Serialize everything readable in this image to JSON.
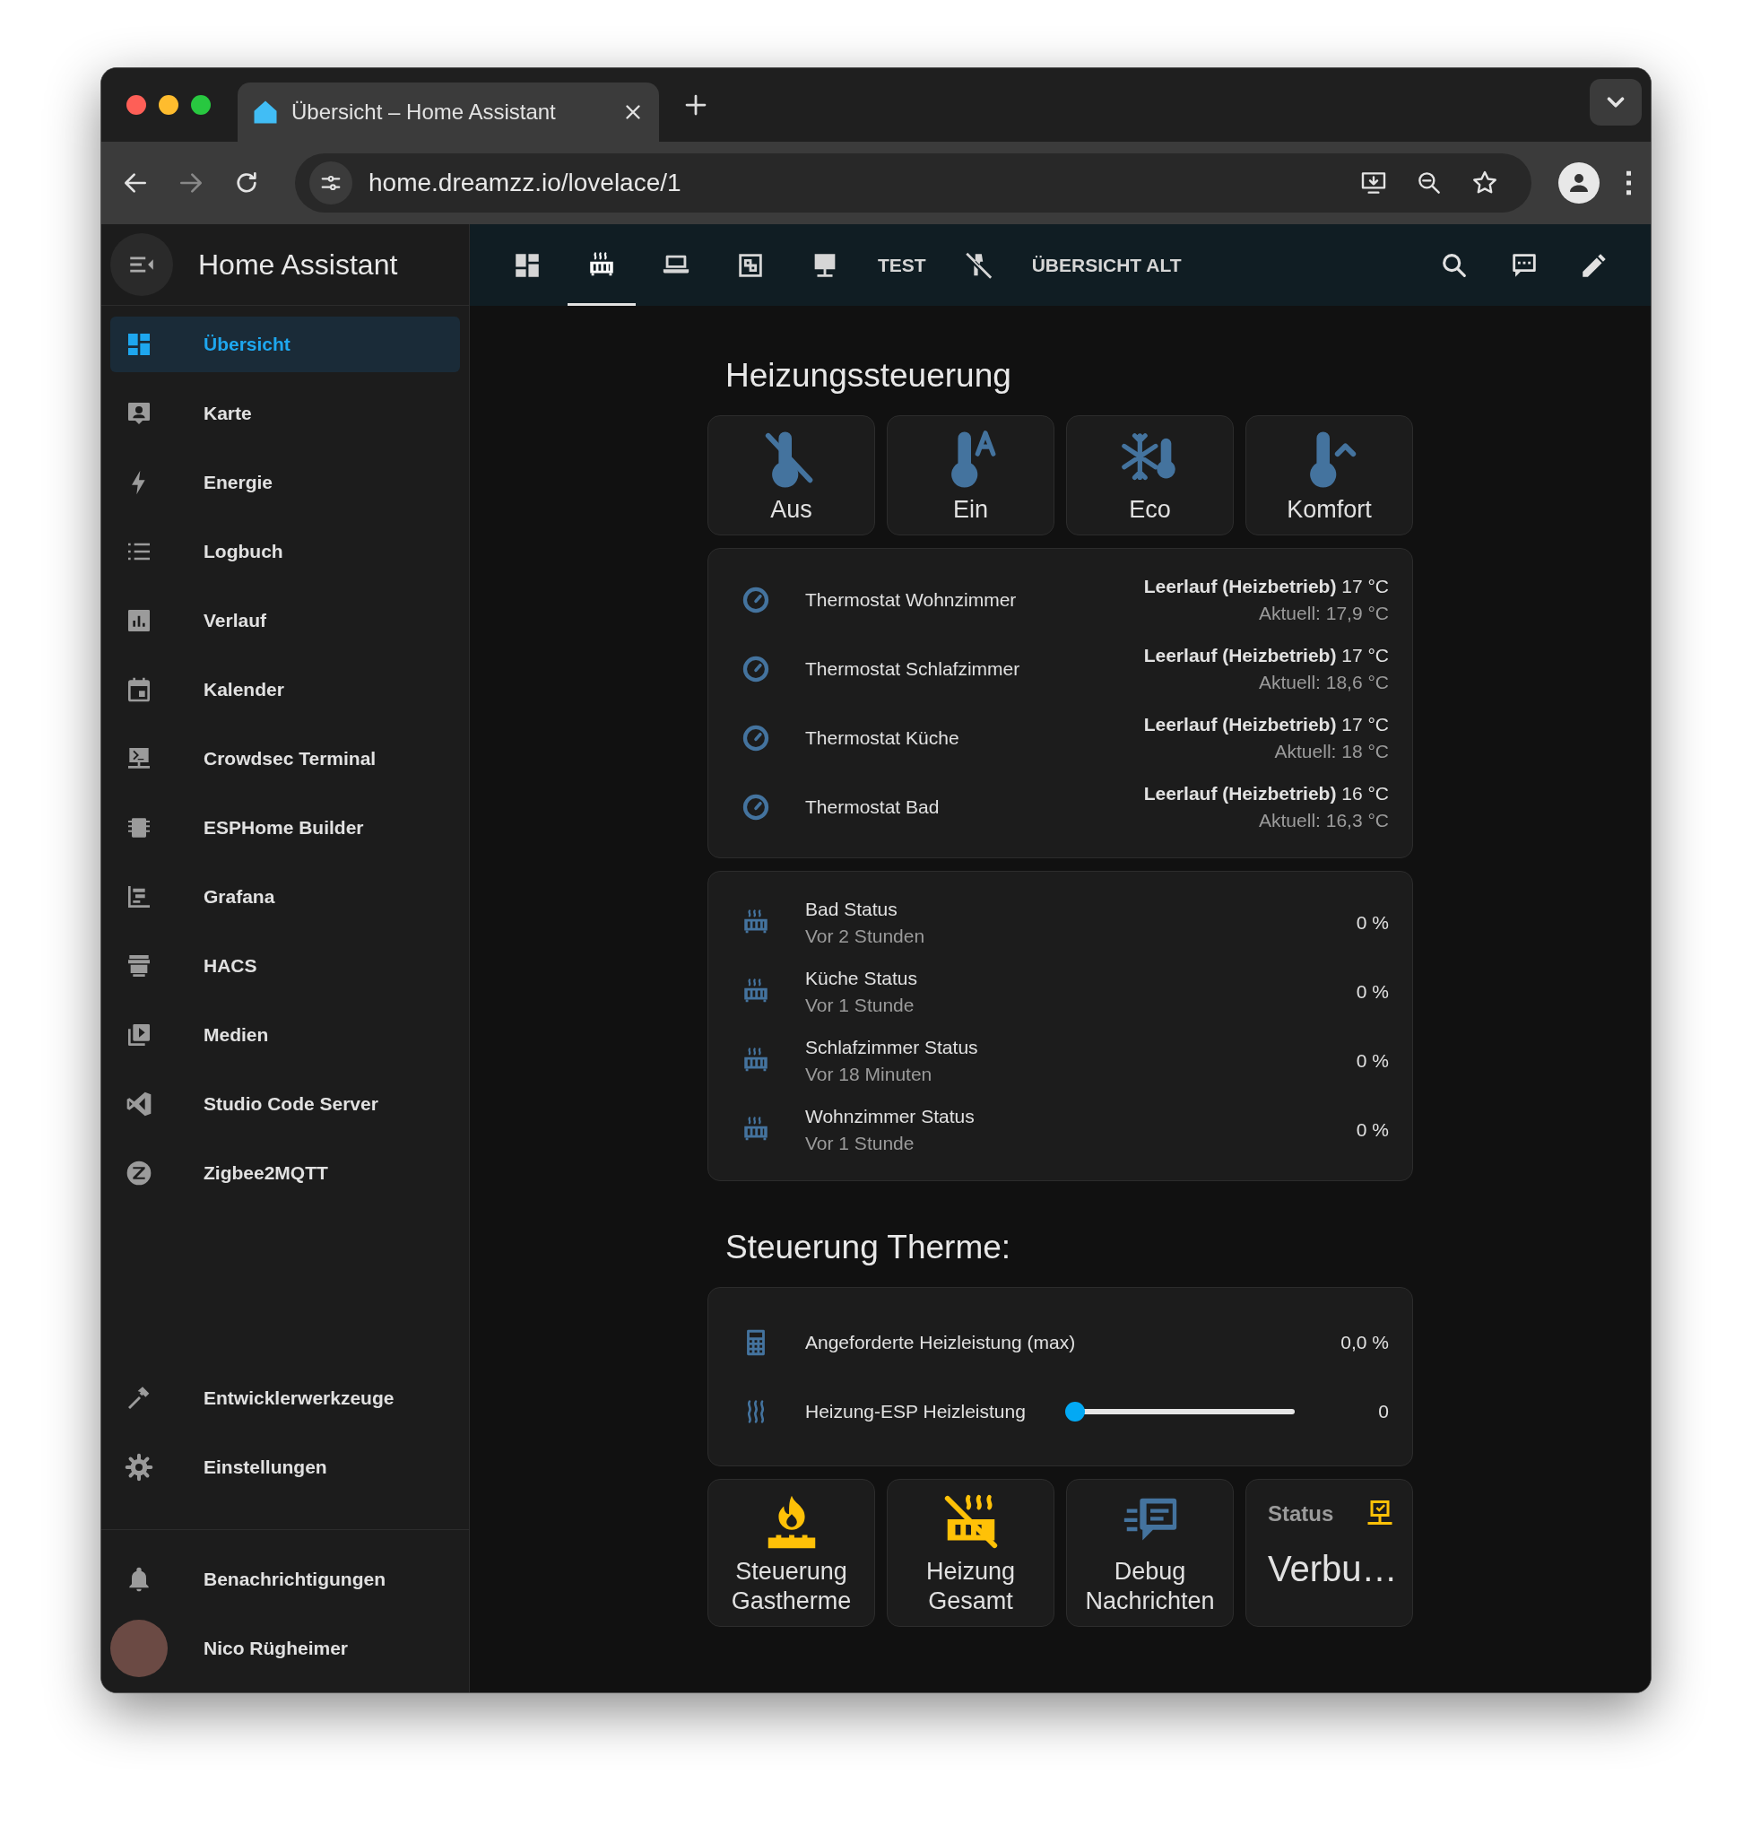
{
  "browser": {
    "tab_title": "Übersicht – Home Assistant",
    "url": "home.dreamzz.io/lovelace/1"
  },
  "sidebar": {
    "title": "Home Assistant",
    "items": [
      {
        "label": "Übersicht",
        "selected": true
      },
      {
        "label": "Karte",
        "selected": false
      },
      {
        "label": "Energie",
        "selected": false
      },
      {
        "label": "Logbuch",
        "selected": false
      },
      {
        "label": "Verlauf",
        "selected": false
      },
      {
        "label": "Kalender",
        "selected": false
      },
      {
        "label": "Crowdsec Terminal",
        "selected": false
      },
      {
        "label": "ESPHome Builder",
        "selected": false
      },
      {
        "label": "Grafana",
        "selected": false
      },
      {
        "label": "HACS",
        "selected": false
      },
      {
        "label": "Medien",
        "selected": false
      },
      {
        "label": "Studio Code Server",
        "selected": false
      },
      {
        "label": "Zigbee2MQTT",
        "selected": false
      }
    ],
    "bottom_items": [
      {
        "label": "Entwicklerwerkzeuge",
        "selected": false
      },
      {
        "label": "Einstellungen",
        "selected": false
      }
    ],
    "notifications": {
      "label": "Benachrichtigungen"
    },
    "user": {
      "name": "Nico Rügheimer"
    }
  },
  "header": {
    "tabs": [
      {
        "kind": "icon",
        "selected": false
      },
      {
        "kind": "icon",
        "selected": true
      },
      {
        "kind": "icon",
        "selected": false
      },
      {
        "kind": "icon",
        "selected": false
      },
      {
        "kind": "icon",
        "selected": false
      },
      {
        "kind": "text",
        "label": "TEST",
        "selected": false
      },
      {
        "kind": "icon",
        "selected": false
      },
      {
        "kind": "text",
        "label": "ÜBERSICHT ALT",
        "selected": false
      }
    ]
  },
  "heating": {
    "title": "Heizungssteuerung",
    "modes": [
      {
        "label": "Aus"
      },
      {
        "label": "Ein"
      },
      {
        "label": "Eco"
      },
      {
        "label": "Komfort"
      }
    ],
    "thermostats": [
      {
        "name": "Thermostat Wohnzimmer",
        "state": "**Leerlauf (Heizbetrieb)** 17 °C",
        "current": "Aktuell: 17,9 °C"
      },
      {
        "name": "Thermostat Schlafzimmer",
        "state": "**Leerlauf (Heizbetrieb)** 17 °C",
        "current": "Aktuell: 18,6 °C"
      },
      {
        "name": "Thermostat Küche",
        "state": "**Leerlauf (Heizbetrieb)** 17 °C",
        "current": "Aktuell: 18 °C"
      },
      {
        "name": "Thermostat Bad",
        "state": "**Leerlauf (Heizbetrieb)** 16 °C",
        "current": "Aktuell: 16,3 °C"
      }
    ],
    "statuses": [
      {
        "name": "Bad Status",
        "time": "Vor 2 Stunden",
        "value": "0 %"
      },
      {
        "name": "Küche Status",
        "time": "Vor 1 Stunde",
        "value": "0 %"
      },
      {
        "name": "Schlafzimmer Status",
        "time": "Vor 18 Minuten",
        "value": "0 %"
      },
      {
        "name": "Wohnzimmer Status",
        "time": "Vor 1 Stunde",
        "value": "0 %"
      }
    ]
  },
  "therme": {
    "title": "Steuerung Therme:",
    "entities": [
      {
        "kind": "value",
        "name": "Angeforderte Heizleistung (max)",
        "value": "0,0 %"
      },
      {
        "kind": "slider",
        "name": "Heizung-ESP Heizleistung",
        "level": 0,
        "reading": "0"
      }
    ],
    "tiles": [
      {
        "kind": "button",
        "label": "Steuerung Gastherme",
        "color": "#ffc107"
      },
      {
        "kind": "button",
        "label": "Heizung Gesamt",
        "color": "#ffc107"
      },
      {
        "kind": "button",
        "label": "Debug Nachrichten",
        "color": "#44739e"
      },
      {
        "kind": "entity",
        "name": "Status",
        "state": "Verbu…",
        "color": "#ffc107"
      }
    ]
  }
}
